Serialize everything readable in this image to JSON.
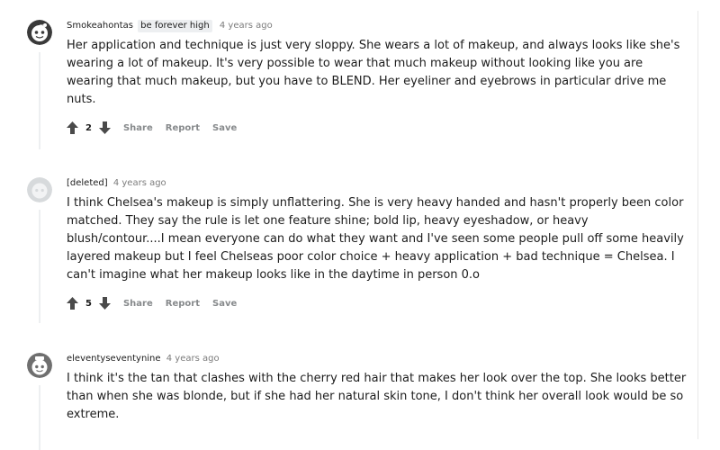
{
  "comments": [
    {
      "author": "Smokeahontas",
      "flair": "be forever high",
      "time": "4 years ago",
      "avatar": "snoo-avatar-dark",
      "text": "Her application and technique is just very sloppy. She wears a lot of makeup, and always looks like she's wearing a lot of makeup. It's very possible to wear that much makeup without looking like you are wearing that much makeup, but you have to BLEND. Her eyeliner and eyebrows in particular drive me nuts.",
      "score": "2",
      "share": "Share",
      "report": "Report",
      "save": "Save"
    },
    {
      "author": "[deleted]",
      "time": "4 years ago",
      "avatar": "deleted-avatar",
      "text": "I think Chelsea's makeup is simply unflattering. She is very heavy handed and hasn't properly been color matched. They say the rule is let one feature shine; bold lip, heavy eyeshadow, or heavy blush/contour....I mean everyone can do what they want and I've seen some people pull off some heavily layered makeup but I feel Chelseas poor color choice + heavy application + bad technique = Chelsea. I can't imagine what her makeup looks like in the daytime in person 0.o",
      "score": "5",
      "share": "Share",
      "report": "Report",
      "save": "Save"
    },
    {
      "author": "eleventyseventynine",
      "time": "4 years ago",
      "avatar": "snoo-avatar-grey",
      "text": "I think it's the tan that clashes with the cherry red hair that makes her look over the top. She looks better than when she was blonde, but if she had her natural skin tone, I don't think her overall look would be so extreme."
    }
  ]
}
